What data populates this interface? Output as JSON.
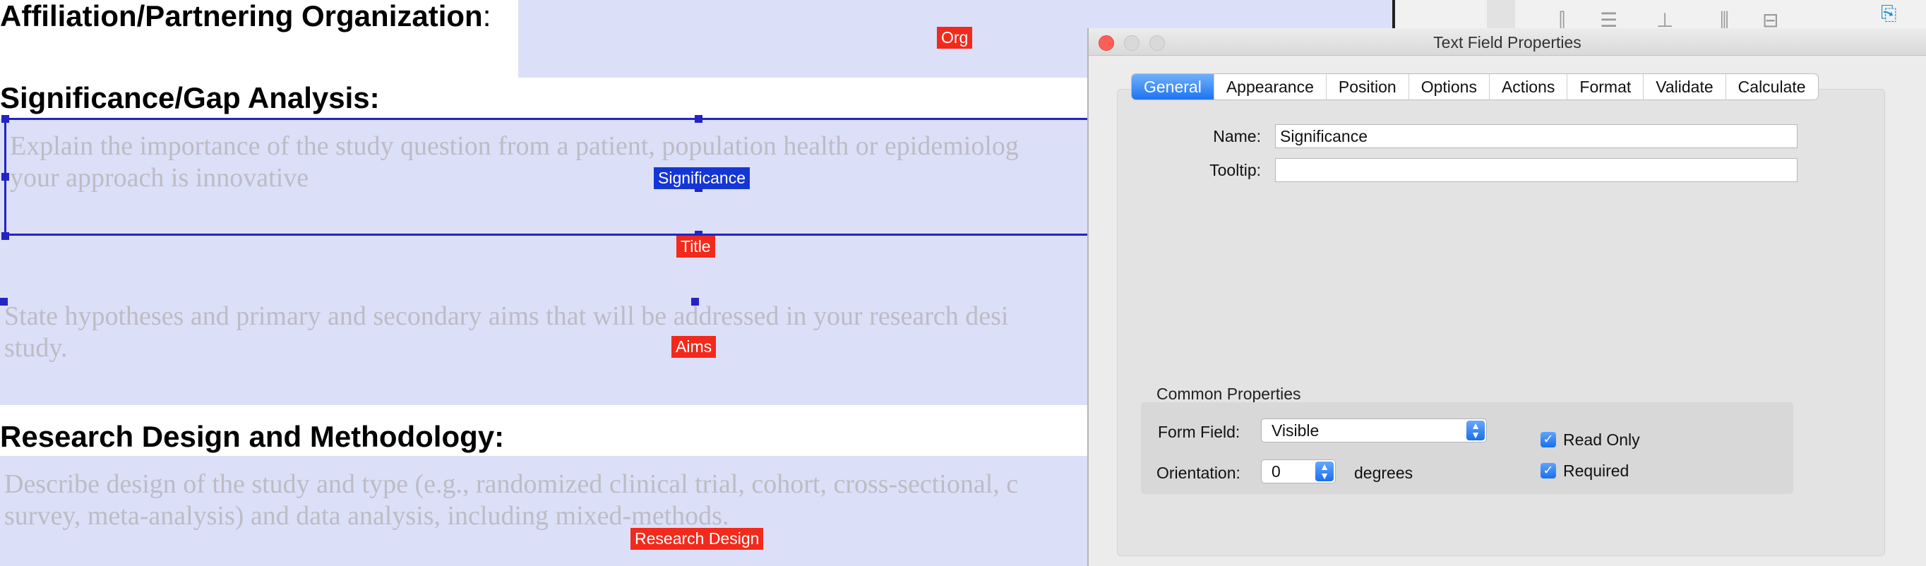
{
  "document": {
    "heading_affiliation": "Affiliation/Partnering Organization",
    "heading_affiliation_suffix": ":",
    "heading_significance": "Significance/Gap Analysis:",
    "heading_research": "Research Design and Methodology:",
    "significance_placeholder_line1": "Explain the importance of the study question from a patient, population health or epidemiolog",
    "significance_placeholder_line2": "your approach is innovative",
    "aims_placeholder_line1": "State hypotheses and primary and secondary aims that will be addressed in your research desi",
    "aims_placeholder_line2": "study.",
    "research_placeholder_line1": "Describe design of the study and type (e.g., randomized clinical trial, cohort, cross-sectional, c",
    "research_placeholder_line2": "survey, meta-analysis) and data analysis, including mixed-methods.",
    "field_tags": {
      "org": "Org",
      "significance": "Significance",
      "title": "Title",
      "aims": "Aims",
      "research_design": "Research Design"
    }
  },
  "dialog": {
    "title": "Text Field Properties",
    "tabs": [
      "General",
      "Appearance",
      "Position",
      "Options",
      "Actions",
      "Format",
      "Validate",
      "Calculate"
    ],
    "active_tab": "General",
    "name_label": "Name:",
    "name_value": "Significance",
    "tooltip_label": "Tooltip:",
    "tooltip_value": "",
    "common_properties_title": "Common Properties",
    "form_field_label": "Form Field:",
    "form_field_value": "Visible",
    "orientation_label": "Orientation:",
    "orientation_value": "0",
    "orientation_unit": "degrees",
    "read_only_label": "Read Only",
    "read_only_checked": true,
    "required_label": "Required",
    "required_checked": true
  },
  "colors": {
    "field_highlight": "#dcdff8",
    "field_tag": "#f22a1c",
    "selected_tag": "#1536d6",
    "selection": "#2224c4",
    "accent": "#1c74f2"
  }
}
